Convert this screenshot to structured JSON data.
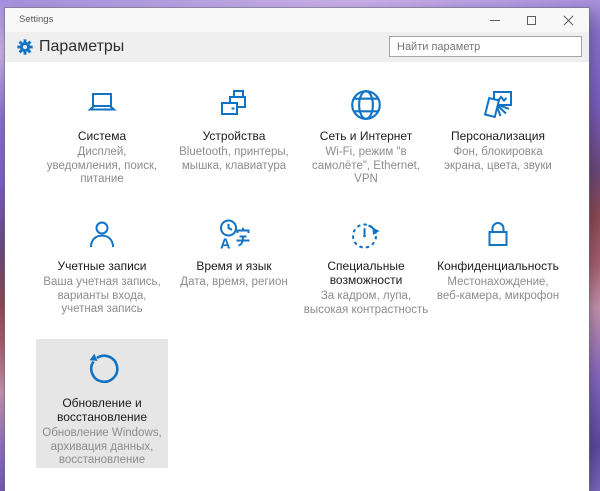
{
  "window": {
    "title": "Settings"
  },
  "header": {
    "app_title": "Параметры",
    "search_placeholder": "Найти параметр"
  },
  "colors": {
    "accent": "#1173c4",
    "tile_highlight": "#e6e6e6",
    "header_bg": "#efefef",
    "titlebar_bg": "#f8f8f8"
  },
  "icons": {
    "header": "gear-icon",
    "titlebar": [
      "minimize-icon",
      "maximize-icon",
      "close-icon"
    ],
    "tiles": [
      "laptop-icon",
      "printer-icon",
      "globe-icon",
      "personalization-icon",
      "person-icon",
      "clock-language-icon",
      "ease-of-access-icon",
      "lock-icon",
      "update-arrow-icon"
    ]
  },
  "tiles": [
    {
      "title": "Система",
      "subtitle": "Дисплей,\nуведомления, поиск,\nпитание",
      "highlighted": false
    },
    {
      "title": "Устройства",
      "subtitle": "Bluetooth, принтеры,\nмышка, клавиатура",
      "highlighted": false
    },
    {
      "title": "Сеть и Интернет",
      "subtitle": "Wi-Fi, режим \"в\nсамолёте\", Ethernet,\nVPN",
      "highlighted": false
    },
    {
      "title": "Персонализация",
      "subtitle": "Фон, блокировка\nэкрана, цвета, звуки",
      "highlighted": false
    },
    {
      "title": "Учетные записи",
      "subtitle": "Ваша учетная запись,\nварианты входа,\nучетная запись",
      "highlighted": false
    },
    {
      "title": "Время и язык",
      "subtitle": "Дата, время, регион",
      "highlighted": false
    },
    {
      "title": "Специальные\nвозможности",
      "subtitle": "За кадром, лупа,\nвысокая контрастность",
      "highlighted": false
    },
    {
      "title": "Конфиденциальность",
      "subtitle": "Местонахождение,\nвеб-камера, микрофон",
      "highlighted": false
    },
    {
      "title": "Обновление и\nвосстановление",
      "subtitle": "Обновление Windows,\nархивация данных,\nвосстановление",
      "highlighted": true
    }
  ]
}
